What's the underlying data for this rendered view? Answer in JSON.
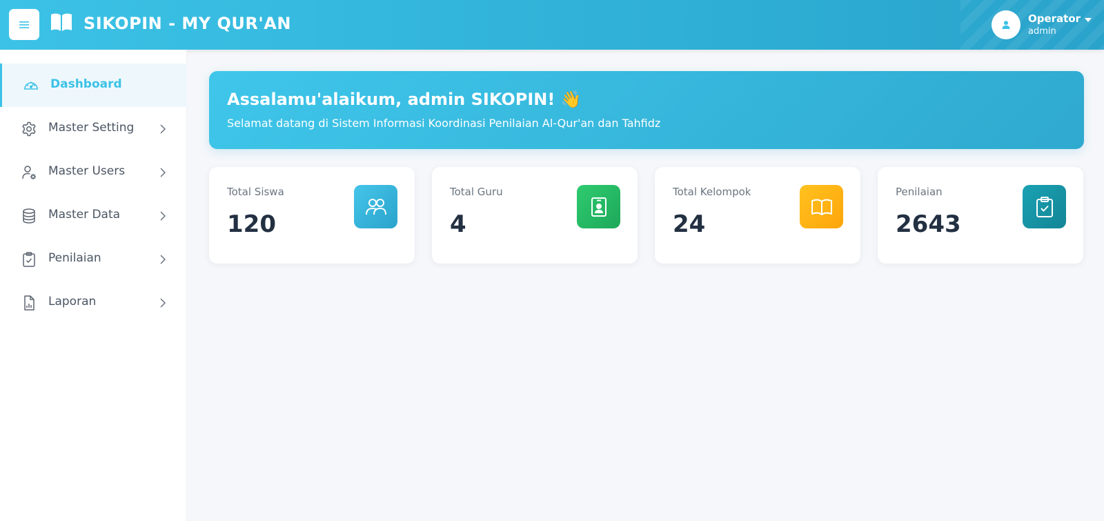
{
  "header": {
    "app_title": "SIKOPIN - MY QUR'AN",
    "menu_icon": "hamburger-icon",
    "logo_icon": "open-book-icon",
    "user": {
      "role": "Operator",
      "name": "admin",
      "avatar_icon": "user-icon"
    }
  },
  "sidebar": {
    "items": [
      {
        "label": "Dashboard",
        "icon": "gauge-icon",
        "active": true
      },
      {
        "label": "Master Setting",
        "icon": "gear-icon",
        "has_submenu": true
      },
      {
        "label": "Master Users",
        "icon": "user-cog-icon",
        "has_submenu": true
      },
      {
        "label": "Master Data",
        "icon": "database-icon",
        "has_submenu": true
      },
      {
        "label": "Penilaian",
        "icon": "clipboard-check-icon",
        "has_submenu": true
      },
      {
        "label": "Laporan",
        "icon": "report-chart-icon",
        "has_submenu": true
      }
    ]
  },
  "welcome": {
    "title": "Assalamu'alaikum, admin SIKOPIN! 👋",
    "subtitle": "Selamat datang di Sistem Informasi Koordinasi Penilaian Al-Qur'an dan Tahfidz"
  },
  "stats": [
    {
      "label": "Total Siswa",
      "value": "120",
      "icon": "users-icon",
      "color": "#2fb0d6"
    },
    {
      "label": "Total Guru",
      "value": "4",
      "icon": "id-badge-icon",
      "color": "#22b864"
    },
    {
      "label": "Total Kelompok",
      "value": "24",
      "icon": "book-icon",
      "color": "#ffb413"
    },
    {
      "label": "Penilaian",
      "value": "2643",
      "icon": "clipboard-check-icon",
      "color": "#1794a5"
    }
  ],
  "colors": {
    "primary": "#3cc2e6",
    "text_dark": "#233042"
  }
}
